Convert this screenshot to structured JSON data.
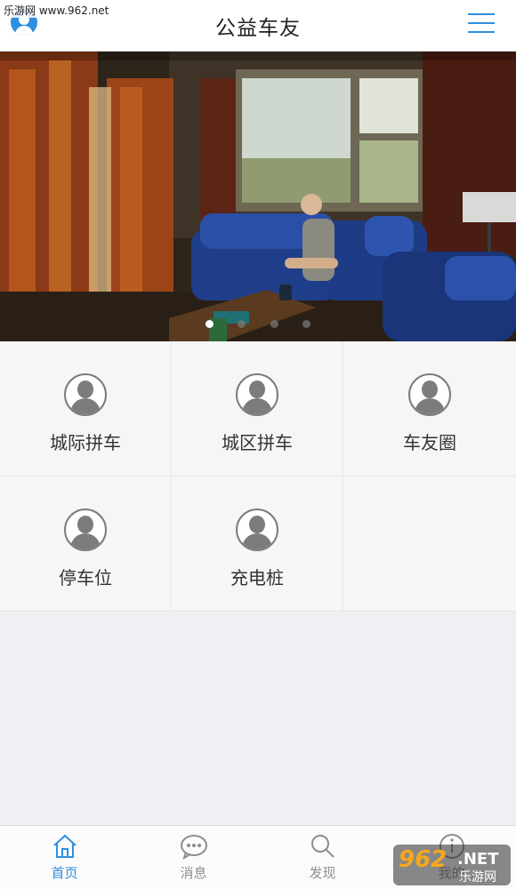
{
  "watermark_top": "乐游网 www.962.net",
  "header": {
    "title": "公益车友"
  },
  "banner": {
    "slides": 4,
    "active_slide": 1
  },
  "grid": {
    "items": [
      {
        "label": "城际拼车"
      },
      {
        "label": "城区拼车"
      },
      {
        "label": "车友圈"
      },
      {
        "label": "停车位"
      },
      {
        "label": "充电桩"
      }
    ]
  },
  "tabbar": {
    "items": [
      {
        "label": "首页",
        "icon": "home-icon",
        "active": true
      },
      {
        "label": "消息",
        "icon": "chat-bubble-icon",
        "active": false
      },
      {
        "label": "发现",
        "icon": "search-icon",
        "active": false
      },
      {
        "label": "我的",
        "icon": "info-icon",
        "active": false
      }
    ]
  },
  "watermark_bottom": {
    "number": "962",
    "suffix": ".NET",
    "cn": "乐游网"
  },
  "colors": {
    "accent": "#2e8fe0",
    "tab_inactive": "#8e8e8e",
    "background": "#efeff4"
  }
}
